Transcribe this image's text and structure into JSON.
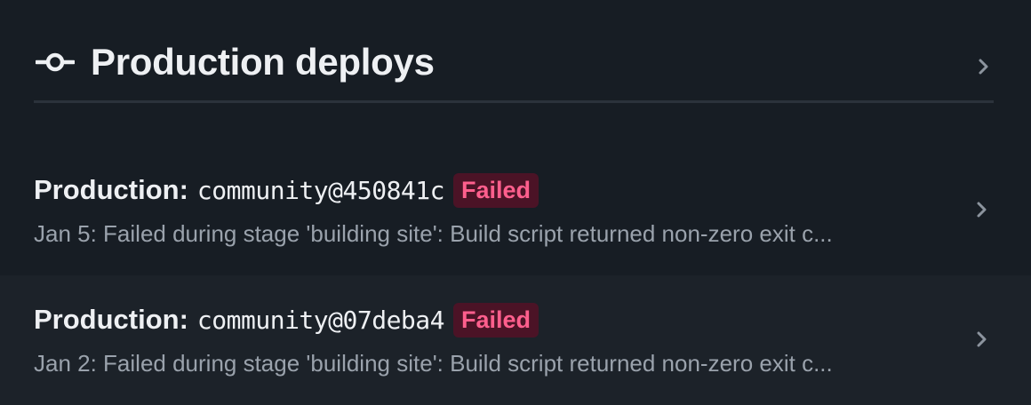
{
  "header": {
    "title": "Production deploys",
    "icon": "commit-icon",
    "chevron_icon": "chevron-right-icon"
  },
  "deploys": [
    {
      "environment": "Production:",
      "ref": "community@450841c",
      "status": "Failed",
      "summary": "Jan 5: Failed during stage 'building site': Build script returned non-zero exit c..."
    },
    {
      "environment": "Production:",
      "ref": "community@07deba4",
      "status": "Failed",
      "summary": "Jan 2: Failed during stage 'building site': Build script returned non-zero exit c..."
    }
  ],
  "colors": {
    "background": "#171d24",
    "row_alt_background": "#1c2229",
    "failed_badge_bg": "#4b1326",
    "failed_badge_text": "#ff5f8d",
    "muted_text": "#9aa2ac"
  }
}
